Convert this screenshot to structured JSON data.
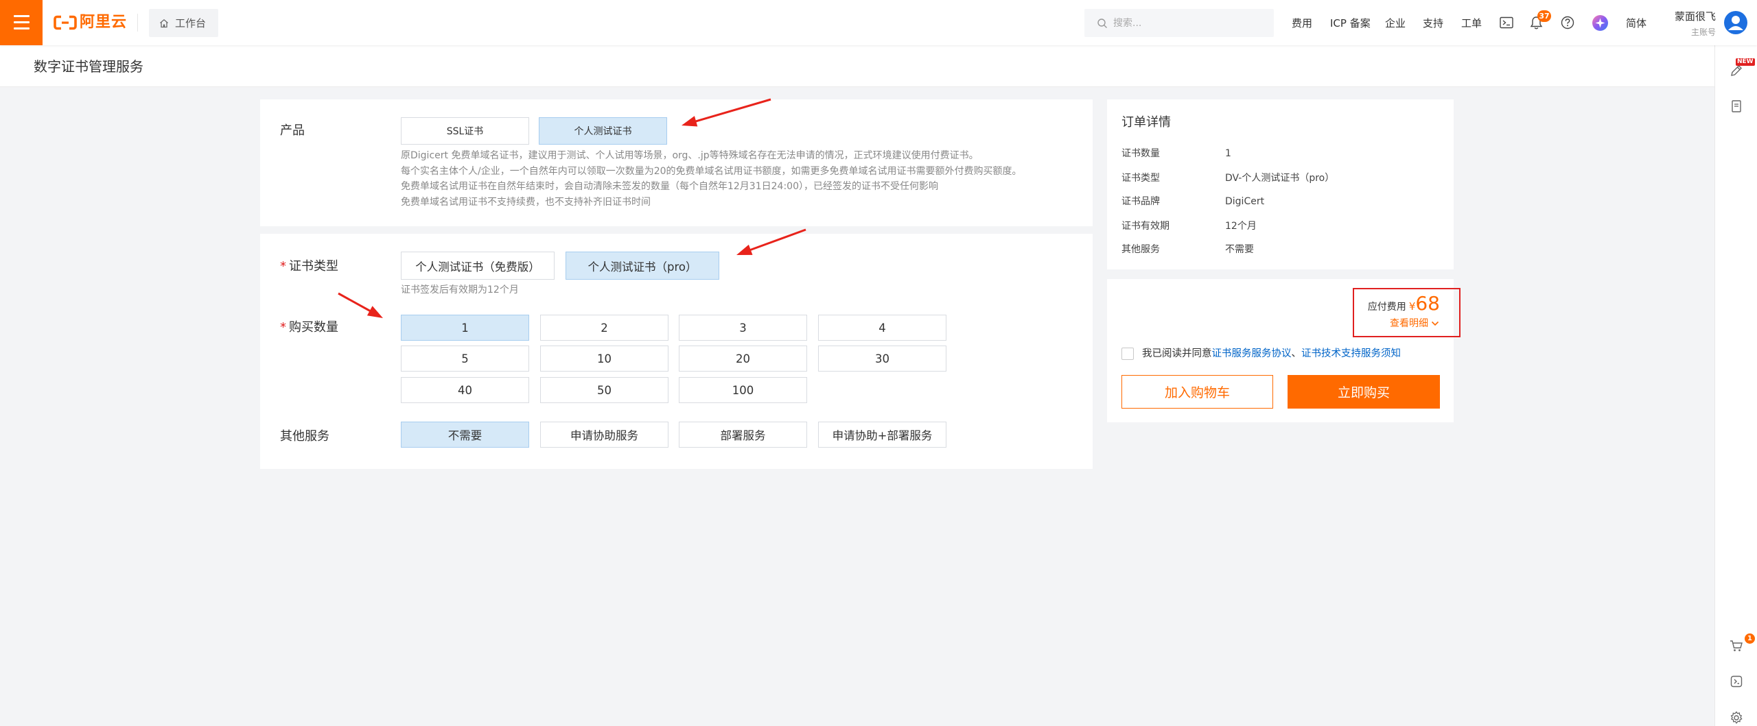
{
  "topbar": {
    "logo_text": "阿里云",
    "workbench": "工作台",
    "search_placeholder": "搜索...",
    "nav": [
      {
        "label": "费用"
      },
      {
        "label": "ICP 备案"
      },
      {
        "label": "企业"
      },
      {
        "label": "支持"
      },
      {
        "label": "工单"
      }
    ],
    "icons": [
      "menu-icon",
      "aliyun-logo-icon",
      "home-icon",
      "search-icon",
      "terminal-icon",
      "bell-icon",
      "help-icon",
      "app-avatar-icon",
      "user-avatar-icon"
    ],
    "notification_badge": "37",
    "language": "简体",
    "user_name": "蒙面很飞",
    "account_type": "主账号"
  },
  "page_title": "数字证书管理服务",
  "form": {
    "product": {
      "label": "产品",
      "options": [
        "SSL证书",
        "个人测试证书"
      ],
      "selected": "个人测试证书",
      "description": [
        "原Digicert 免费单域名证书，建议用于测试、个人试用等场景，org、.jp等特殊域名存在无法申请的情况，正式环境建议使用付费证书。",
        "每个实名主体个人/企业，一个自然年内可以领取一次数量为20的免费单域名试用证书额度，如需更多免费单域名试用证书需要额外付费购买额度。",
        "免费单域名试用证书在自然年结束时，会自动清除未签发的数量（每个自然年12月31日24:00），已经签发的证书不受任何影响",
        "免费单域名试用证书不支持续费，也不支持补齐旧证书时间"
      ]
    },
    "cert_type": {
      "required_mark": "*",
      "label": "证书类型",
      "options": [
        "个人测试证书（免费版）",
        "个人测试证书（pro）"
      ],
      "selected": "个人测试证书（pro）",
      "hint": "证书签发后有效期为12个月"
    },
    "quantity": {
      "required_mark": "*",
      "label": "购买数量",
      "options": [
        "1",
        "2",
        "3",
        "4",
        "5",
        "10",
        "20",
        "30",
        "40",
        "50",
        "100"
      ],
      "selected": "1"
    },
    "other_services": {
      "label": "其他服务",
      "options": [
        "不需要",
        "申请协助服务",
        "部署服务",
        "申请协助+部署服务"
      ],
      "selected": "不需要"
    }
  },
  "order": {
    "title": "订单详情",
    "rows": [
      {
        "label": "证书数量",
        "value": "1"
      },
      {
        "label": "证书类型",
        "value": "DV-个人测试证书（pro）"
      },
      {
        "label": "证书品牌",
        "value": "DigiCert"
      },
      {
        "label": "证书有效期",
        "value": "12个月"
      },
      {
        "label": "其他服务",
        "value": "不需要"
      }
    ]
  },
  "payment": {
    "fee_label": "应付费用",
    "currency": "¥",
    "amount": "68",
    "details_link": "查看明细",
    "agreed": false,
    "agreement_prefix": "我已阅读并同意",
    "agreement_links": [
      "证书服务服务协议",
      "证书技术支持服务须知"
    ],
    "agreement_separator": "、",
    "add_to_cart": "加入购物车",
    "buy_now": "立即购买"
  },
  "sidebar": {
    "items": [
      {
        "icon": "edit-icon",
        "badge": "NEW"
      },
      {
        "icon": "document-icon"
      },
      {
        "icon": "cart-icon",
        "badge": "1"
      },
      {
        "icon": "service-icon"
      },
      {
        "icon": "settings-icon"
      }
    ]
  },
  "colors": {
    "brand_orange": "#ff6a00",
    "link_blue": "#0064c8",
    "selected_bg": "#d6e9f8",
    "required_red": "#e02020",
    "annotation_red": "#e8231b"
  }
}
